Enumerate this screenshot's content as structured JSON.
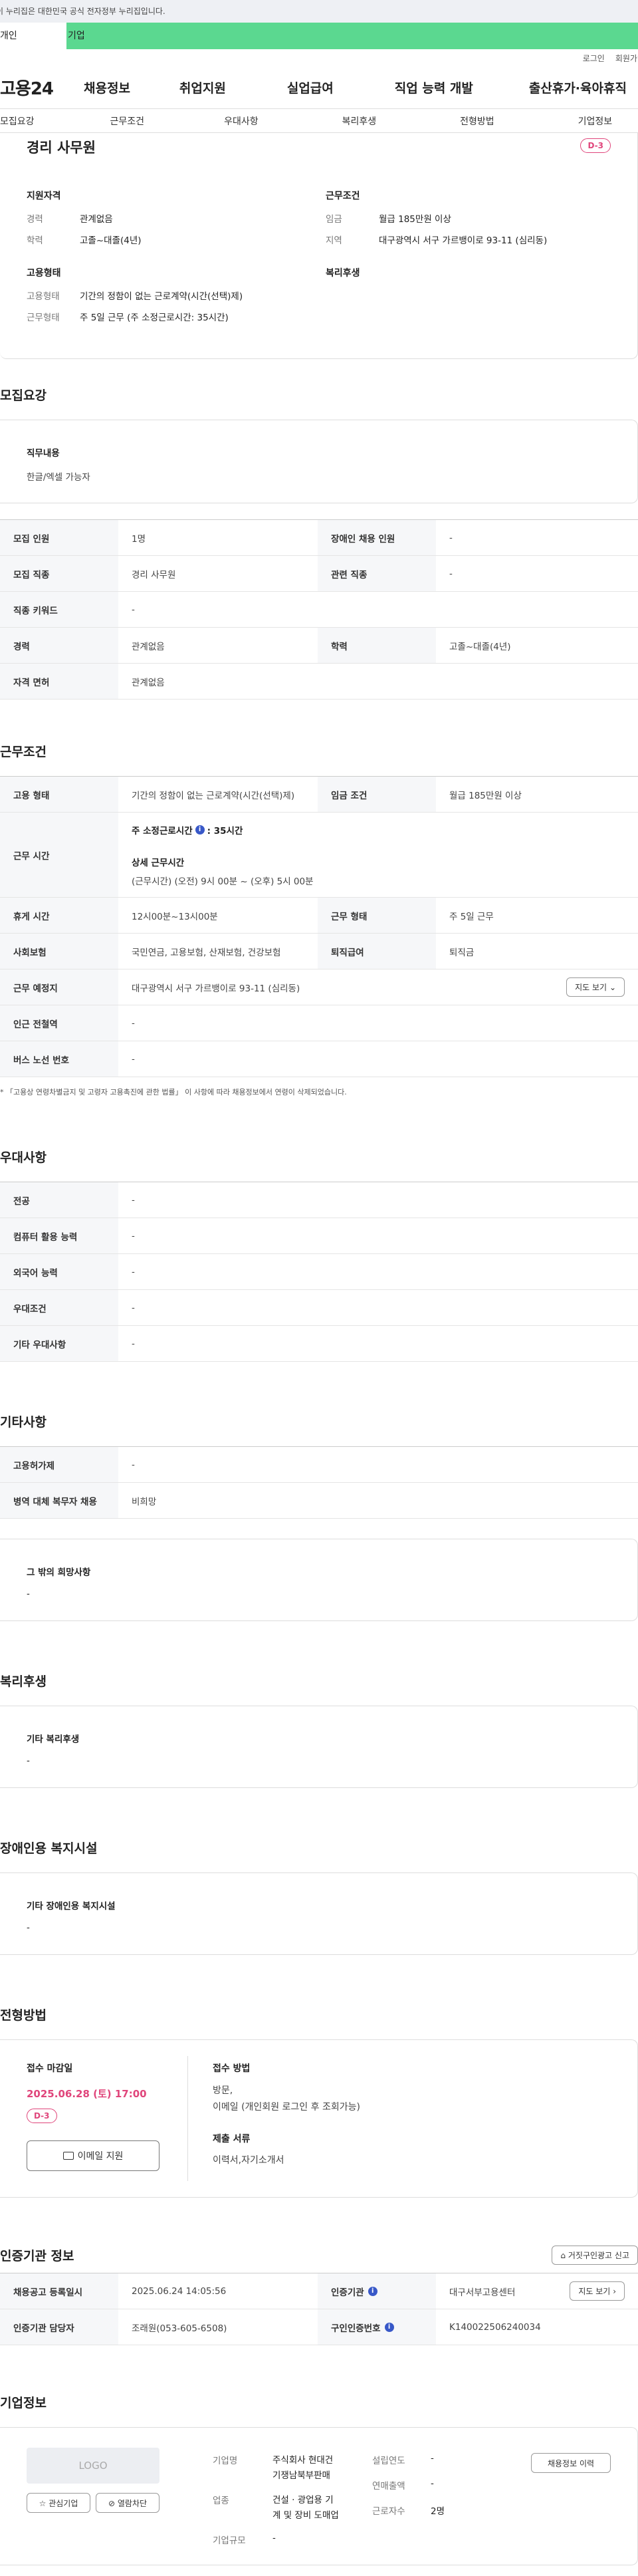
{
  "gov_banner": "이 누리집은 대한민국 공식 전자정부 누리집입니다.",
  "audience_tabs": [
    "개인",
    "기업"
  ],
  "util_links": [
    "로그인",
    "회원가입"
  ],
  "site_logo": "고용24",
  "gnb": [
    "채용정보",
    "취업지원",
    "실업급여",
    "직업 능력 개발",
    "출산휴가·육아휴직"
  ],
  "snb": [
    "모집요강",
    "근무조건",
    "우대사항",
    "복리후생",
    "전형방법",
    "기업정보"
  ],
  "header_card": {
    "title": "경리 사무원",
    "dday": "D-3",
    "qual_title": "지원자격",
    "qual": [
      {
        "k": "경력",
        "v": "관계없음"
      },
      {
        "k": "학력",
        "v": "고졸~대졸(4년)"
      }
    ],
    "cond_title": "근무조건",
    "cond": [
      {
        "k": "임금",
        "v": "월급 185만원 이상"
      },
      {
        "k": "지역",
        "v": "대구광역시 서구 가르뱅이로 93-11 (심리동)"
      }
    ],
    "emp_title": "고용형태",
    "emp": [
      {
        "k": "고용형태",
        "v": "기간의 정함이 없는 근로계약(시간(선택)제)"
      },
      {
        "k": "근무형태",
        "v": "주 5일 근무 (주 소정근로시간: 35시간)"
      }
    ],
    "welfare_title": "복리후생"
  },
  "recruit": {
    "title": "모집요강",
    "duty_label": "직무내용",
    "duty": "한글/엑셀 가능자",
    "rows": [
      {
        "l1": "모집 인원",
        "v1": "1명",
        "l2": "장애인 채용 인원",
        "v2": "-"
      },
      {
        "l1": "모집 직종",
        "v1": "경리 사무원",
        "l2": "관련 직종",
        "v2": "-"
      },
      {
        "l1": "직종 키워드",
        "v1": "-"
      },
      {
        "l1": "경력",
        "v1": "관계없음",
        "l2": "학력",
        "v2": "고졸~대졸(4년)"
      },
      {
        "l1": "자격 면허",
        "v1": "관계없음"
      }
    ]
  },
  "work": {
    "title": "근무조건",
    "type_label": "고용 형태",
    "type": "기간의 정함이 없는 근로계약(시간(선택)제)",
    "wage_label": "임금 조건",
    "wage": "월급 185만원 이상",
    "hours_label": "근무 시간",
    "hours_main": "주 소정근로시간",
    "hours_value": ": 35시간",
    "hours_detail_title": "상세 근무시간",
    "hours_detail": "(근무시간) (오전) 9시 00분 ~ (오후) 5시 00분",
    "rest_label": "휴게 시간",
    "rest": "12시00분~13시00분",
    "form_label": "근무 형태",
    "form": "주 5일 근무",
    "ins_label": "사회보험",
    "ins": "국민연금, 고용보험, 산재보험, 건강보험",
    "sev_label": "퇴직급여",
    "sev": "퇴직금",
    "place_label": "근무 예정지",
    "place": "대구광역시 서구 가르뱅이로 93-11 (심리동)",
    "map_btn": "지도 보기",
    "subway_label": "인근 전철역",
    "subway": "-",
    "bus_label": "버스 노선 번호",
    "bus": "-",
    "note": "* 「고용상 연령차별금지 및 고령자 고용촉진에 관한 법률」 이 사항에 따라 채용정보에서 연령이 삭제되었습니다."
  },
  "prefer": {
    "title": "우대사항",
    "rows": [
      {
        "l": "전공",
        "v": "-"
      },
      {
        "l": "컴퓨터 활용 능력",
        "v": "-"
      },
      {
        "l": "외국어 능력",
        "v": "-"
      },
      {
        "l": "우대조건",
        "v": "-"
      },
      {
        "l": "기타 우대사항",
        "v": "-"
      }
    ]
  },
  "etc": {
    "title": "기타사항",
    "rows": [
      {
        "l": "고용허가제",
        "v": "-"
      },
      {
        "l": "병역 대체 복무자 채용",
        "v": "비희망"
      }
    ],
    "other_label": "그 밖의 희망사항",
    "other": "-"
  },
  "welfare": {
    "title": "복리후생",
    "label": "기타 복리후생",
    "value": "-"
  },
  "disabled": {
    "title": "장애인용 복지시설",
    "label": "기타 장애인용 복지시설",
    "value": "-"
  },
  "selection": {
    "title": "전형방법",
    "deadline_label": "접수 마감일",
    "deadline": "2025.06.28 (토) 17:00",
    "dday": "D-3",
    "email_btn": "이메일 지원",
    "method_label": "접수 방법",
    "method": "방문,\n이메일 (개인회원 로그인 후 조회가능)",
    "docs_label": "제출 서류",
    "docs": "이력서,자기소개서"
  },
  "agency": {
    "title": "인증기관 정보",
    "report_btn": "거짓구인광고 신고",
    "reg_label": "채용공고 등록일시",
    "reg": "2025.06.24 14:05:56",
    "org_label": "인증기관",
    "org": "대구서부고용센터",
    "map_btn": "지도 보기",
    "mgr_label": "인증기관 담당자",
    "mgr": "조래원(053-605-6508)",
    "num_label": "구인인증번호",
    "num": "K140022506240034"
  },
  "company": {
    "title": "기업정보",
    "logo": "LOGO",
    "fav_btn": "관심기업",
    "block_btn": "열람차단",
    "history_btn": "채용정보 이력",
    "name_label": "기업명",
    "name": "주식회사 현대건\n기쟁남북부판매",
    "found_label": "설립연도",
    "found": "-",
    "sales_label": "연매출액",
    "sales": "-",
    "industry_label": "업종",
    "industry": "건설 · 광업용 기\n계 및 장비 도매업",
    "staff_label": "근로자수",
    "staff": "2명",
    "size_label": "기업규모",
    "size": "-"
  }
}
